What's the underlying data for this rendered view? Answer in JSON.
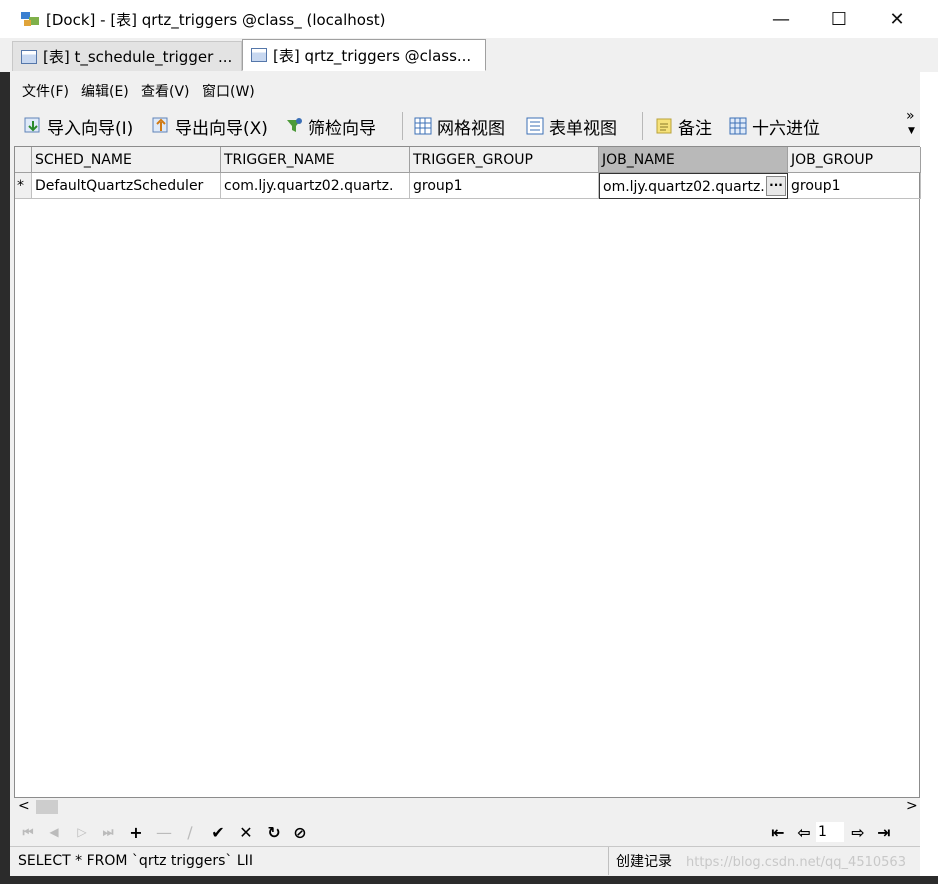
{
  "window": {
    "title": "[Dock] - [表] qrtz_triggers @class_ (localhost)",
    "minimize": "—",
    "maximize": "☐",
    "close": "✕"
  },
  "tabs": [
    {
      "label": "[表] t_schedule_trigger ...",
      "active": false
    },
    {
      "label": "[表] qrtz_triggers @class...",
      "active": true
    }
  ],
  "menu": [
    "文件(F)",
    "编辑(E)",
    "查看(V)",
    "窗口(W)"
  ],
  "toolbar": {
    "import": "导入向导(I)",
    "export": "导出向导(X)",
    "filter": "筛检向导",
    "grid_view": "网格视图",
    "form_view": "表单视图",
    "memo": "备注",
    "hex": "十六进位",
    "overflow": "»"
  },
  "table": {
    "columns": [
      "SCHED_NAME",
      "TRIGGER_NAME",
      "TRIGGER_GROUP",
      "JOB_NAME",
      "JOB_GROUP"
    ],
    "rows": [
      {
        "marker": "*",
        "cells": [
          "DefaultQuartzScheduler",
          "com.ljy.quartz02.quartz.",
          "group1",
          "om.ljy.quartz02.quartz.",
          "group1"
        ]
      }
    ],
    "ellipsis_button": "···"
  },
  "scroll": {
    "left": "<",
    "right": ">"
  },
  "nav": {
    "first": "⏮",
    "prev": "◀",
    "next": "▷",
    "last": "⏭",
    "add": "+",
    "delete": "—",
    "edit": "∕",
    "apply": "✔",
    "cancel": "✕",
    "refresh": "↻",
    "stop": "⊘",
    "page_first": "⇤",
    "page_prev": "⇦",
    "page_number": "1",
    "page_next": "⇨",
    "page_last": "⇥"
  },
  "status": {
    "sql": "SELECT * FROM `qrtz triggers` LII",
    "action": "创建记录",
    "watermark": "https://blog.csdn.net/qq_4510563"
  },
  "colors": {
    "accent": "#3b6fb6",
    "header_selected": "#b9b9b9"
  }
}
